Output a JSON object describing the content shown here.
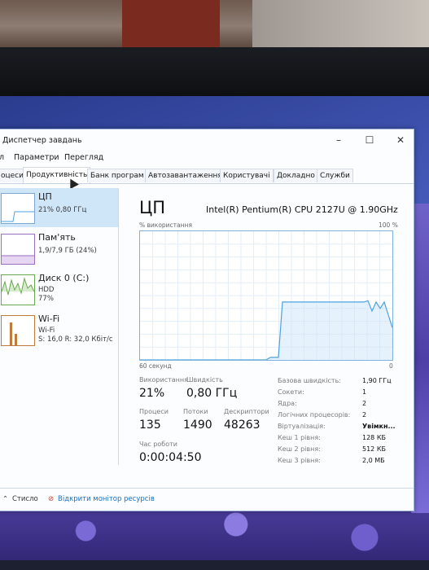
{
  "window": {
    "title": "Диспетчер завдань"
  },
  "menu": [
    "л",
    "Параметри",
    "Перегляд"
  ],
  "tabs": [
    "оцеси",
    "Продуктивність",
    "Банк програм",
    "Автозавантаження",
    "Користувачі",
    "Докладно",
    "Служби"
  ],
  "active_tab": "Продуктивність",
  "sidebar": [
    {
      "name": "ЦП",
      "sub1": "21% 0,80 ГГц",
      "sub2": ""
    },
    {
      "name": "Пам'ять",
      "sub1": "1,9/7,9 ГБ (24%)",
      "sub2": ""
    },
    {
      "name": "Диск 0 (C:)",
      "sub1": "HDD",
      "sub2": "77%"
    },
    {
      "name": "Wi-Fi",
      "sub1": "Wi-Fi",
      "sub2": "S: 16,0 R: 32,0 Кбіт/с"
    }
  ],
  "main": {
    "title": "ЦП",
    "model": "Intel(R) Pentium(R) CPU 2127U @ 1.90GHz",
    "usage_label": "% використання",
    "usage_max": "100 %",
    "graph_time": "60 секунд",
    "graph_zero": "0",
    "graph_series": [
      0,
      0,
      0,
      0,
      0,
      0,
      0,
      0,
      0,
      0,
      0,
      0,
      0,
      0,
      0,
      0,
      0,
      0,
      0,
      0,
      0,
      0,
      0,
      0,
      0,
      0,
      0,
      0,
      0,
      0,
      0,
      0,
      2,
      2,
      2,
      45,
      45,
      45,
      45,
      45,
      45,
      45,
      45,
      45,
      45,
      45,
      45,
      45,
      45,
      45,
      45,
      45,
      45,
      45,
      45,
      45,
      46,
      38,
      45,
      40,
      45,
      35,
      25
    ]
  },
  "stats": {
    "usage_label": "Використання",
    "usage_value": "21%",
    "speed_label": "Швидкість",
    "speed_value": "0,80 ГГц",
    "processes_label": "Процеси",
    "processes_value": "135",
    "threads_label": "Потоки",
    "threads_value": "1490",
    "handles_label": "Дескриптори",
    "handles_value": "48263",
    "uptime_label": "Час роботи",
    "uptime_value": "0:00:04:50"
  },
  "specs": [
    {
      "key": "Базова швидкість:",
      "value": "1,90 ГГц"
    },
    {
      "key": "Сокети:",
      "value": "1"
    },
    {
      "key": "Ядра:",
      "value": "2"
    },
    {
      "key": "Логічних процесорів:",
      "value": "2"
    },
    {
      "key": "Віртуалізація:",
      "value": "Увімкн..."
    },
    {
      "key": "Кеш 1 рівня:",
      "value": "128 КБ"
    },
    {
      "key": "Кеш 2 рівня:",
      "value": "512 КБ"
    },
    {
      "key": "Кеш 3 рівня:",
      "value": "2,0 МБ"
    }
  ],
  "footer": {
    "less": "Стисло",
    "monitor": "Відкрити монітор ресурсів"
  },
  "colors": {
    "accent": "#117dbb",
    "graph_line": "#4aa3df",
    "graph_fill": "#cce4f7",
    "active_bg": "#cfe5f8"
  }
}
